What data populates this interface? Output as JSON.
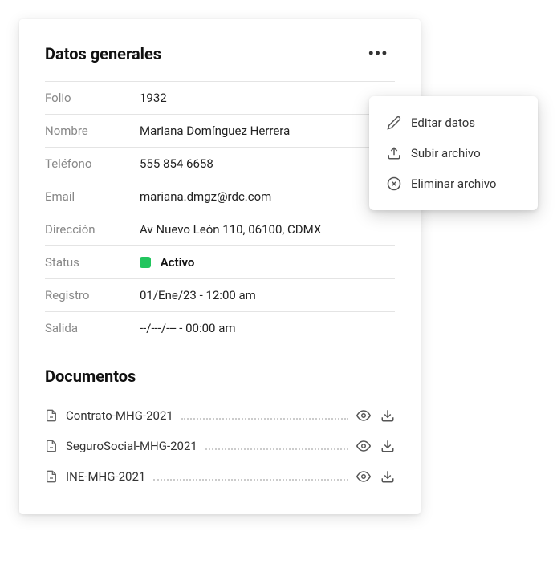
{
  "general": {
    "title": "Datos generales",
    "fields": {
      "folio": {
        "label": "Folio",
        "value": "1932"
      },
      "nombre": {
        "label": "Nombre",
        "value": "Mariana Domínguez Herrera"
      },
      "telefono": {
        "label": "Teléfono",
        "value": "555 854 6658"
      },
      "email": {
        "label": "Email",
        "value": "mariana.dmgz@rdc.com"
      },
      "direccion": {
        "label": "Dirección",
        "value": "Av Nuevo León 110, 06100, CDMX"
      },
      "status": {
        "label": "Status",
        "value": "Activo",
        "color": "#22c55e"
      },
      "registro": {
        "label": "Registro",
        "value": "01/Ene/23 - 12:00 am"
      },
      "salida": {
        "label": "Salida",
        "value": "--/---/--- - 00:00 am"
      }
    }
  },
  "documents": {
    "title": "Documentos",
    "items": [
      {
        "name": "Contrato-MHG-2021"
      },
      {
        "name": "SeguroSocial-MHG-2021"
      },
      {
        "name": "INE-MHG-2021"
      }
    ]
  },
  "menu": {
    "edit": "Editar datos",
    "upload": "Subir archivo",
    "delete": "Eliminar archivo"
  }
}
